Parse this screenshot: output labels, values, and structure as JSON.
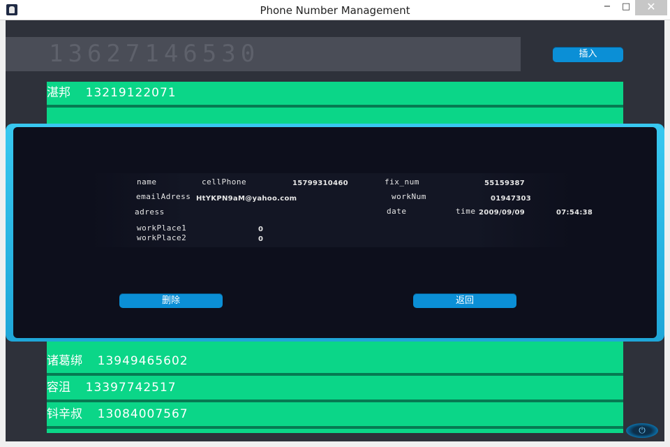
{
  "window": {
    "title": "Phone Number Management",
    "minimize": "−",
    "maximize": "□",
    "close": "✕"
  },
  "display": {
    "number": "13627146530"
  },
  "toolbar": {
    "insert_label": "插入"
  },
  "contacts": [
    {
      "name": "湛邦",
      "phone": "13219122071"
    },
    {
      "name": "诸葛绑",
      "phone": "13949465602"
    },
    {
      "name": "容沮",
      "phone": "13397742517"
    },
    {
      "name": "钭辛叔",
      "phone": "13084007567"
    }
  ],
  "detail": {
    "labels": {
      "name": "name",
      "cellPhone": "cellPhone",
      "fix_num": "fix_num",
      "emailAdress": "emailAdress",
      "workNum": "workNum",
      "adress": "adress",
      "date": "date",
      "time": "time",
      "workPlace1": "workPlace1",
      "workPlace2": "workPlace2"
    },
    "values": {
      "cellPhone": "15799310460",
      "fix_num": "55159387",
      "emailAdress": "HtYKPN9aM@yahoo.com",
      "workNum": "01947303",
      "date": "2009/09/09",
      "time": "07:54:38",
      "workPlace1": "0",
      "workPlace2": "0"
    },
    "delete_label": "删除",
    "back_label": "返回"
  },
  "icons": {
    "app": "app-icon",
    "power": "power-icon"
  },
  "colors": {
    "list_green": "#0bd688",
    "button_blue": "#0b8fd6",
    "dialog_border": "#38c8f0"
  }
}
